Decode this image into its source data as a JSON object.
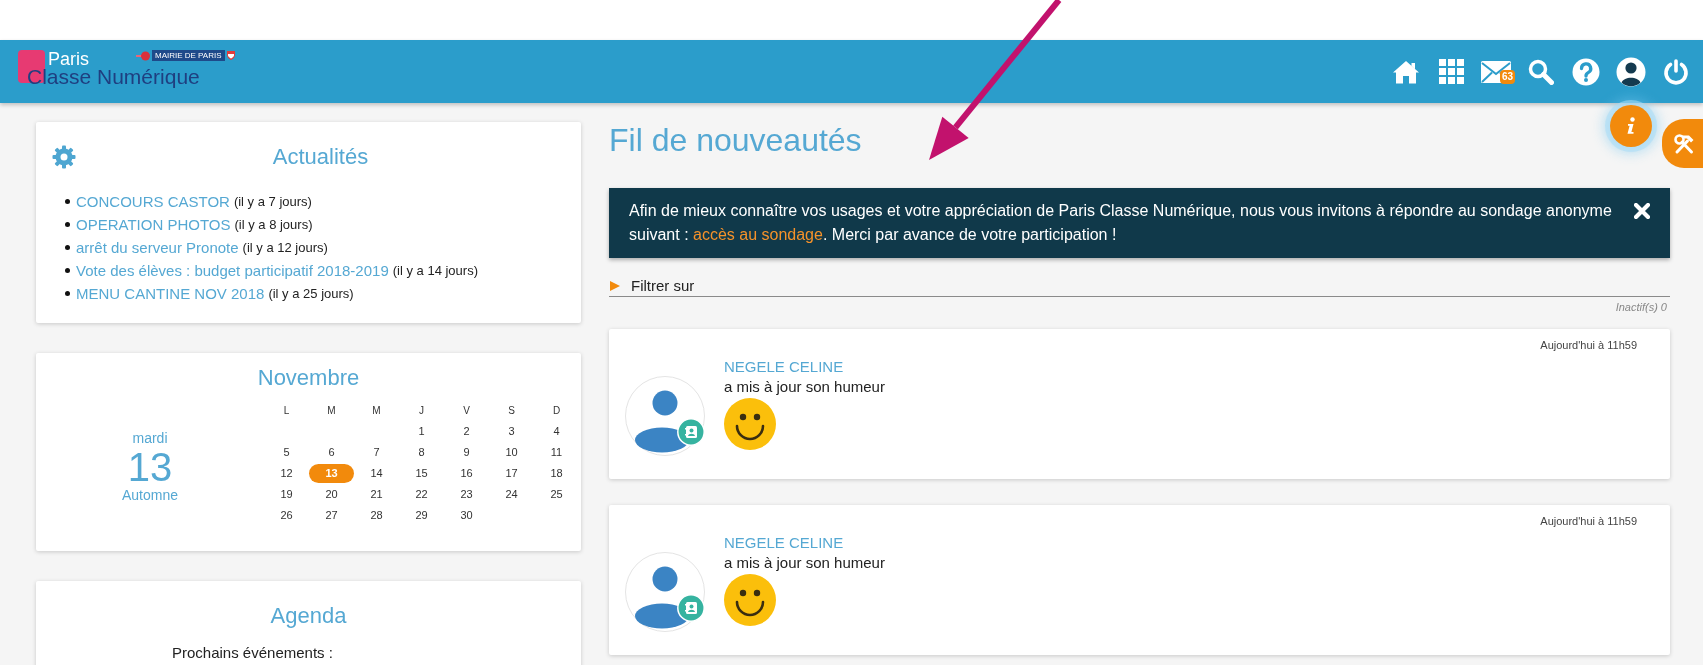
{
  "header": {
    "logo": {
      "line_1": "Paris",
      "line_2": "Classe Numérique",
      "badge": "MAIRIE DE PARIS"
    },
    "icons": [
      {
        "kind": "home"
      },
      {
        "kind": "apps"
      },
      {
        "kind": "mail",
        "badge": "63"
      },
      {
        "kind": "search"
      },
      {
        "kind": "help"
      },
      {
        "kind": "account"
      },
      {
        "kind": "power"
      }
    ]
  },
  "news_card": {
    "title": "Actualités",
    "items": [
      {
        "title": "CONCOURS CASTOR",
        "age": "(il y a 7 jours)"
      },
      {
        "title": "OPERATION PHOTOS",
        "age": "(il y a 8 jours)"
      },
      {
        "title": "arrêt du serveur Pronote",
        "age": "(il y a 12 jours)"
      },
      {
        "title": "Vote des élèves : budget participatif 2018-2019",
        "age": "(il y a 14 jours)"
      },
      {
        "title": "MENU CANTINE NOV 2018",
        "age": "(il y a 25 jours)"
      }
    ]
  },
  "calendar_card": {
    "month": "Novembre",
    "weekday": "mardi",
    "day": "13",
    "season": "Automne",
    "weekdays": [
      "L",
      "M",
      "M",
      "J",
      "V",
      "S",
      "D"
    ],
    "weeks": [
      [
        {
          "kind": "blank"
        },
        {
          "kind": "blank"
        },
        {
          "kind": "blank"
        },
        {
          "kind": "day",
          "label": "1",
          "selected": false
        },
        {
          "kind": "day",
          "label": "2",
          "selected": false
        },
        {
          "kind": "day",
          "label": "3",
          "selected": false
        },
        {
          "kind": "day",
          "label": "4",
          "selected": false
        }
      ],
      [
        {
          "kind": "day",
          "label": "5",
          "selected": false
        },
        {
          "kind": "day",
          "label": "6",
          "selected": false
        },
        {
          "kind": "day",
          "label": "7",
          "selected": false
        },
        {
          "kind": "day",
          "label": "8",
          "selected": false
        },
        {
          "kind": "day",
          "label": "9",
          "selected": false
        },
        {
          "kind": "day",
          "label": "10",
          "selected": false
        },
        {
          "kind": "day",
          "label": "11",
          "selected": false
        }
      ],
      [
        {
          "kind": "day",
          "label": "12",
          "selected": false
        },
        {
          "kind": "day",
          "label": "13",
          "selected": true
        },
        {
          "kind": "day",
          "label": "14",
          "selected": false
        },
        {
          "kind": "day",
          "label": "15",
          "selected": false
        },
        {
          "kind": "day",
          "label": "16",
          "selected": false
        },
        {
          "kind": "day",
          "label": "17",
          "selected": false
        },
        {
          "kind": "day",
          "label": "18",
          "selected": false
        }
      ],
      [
        {
          "kind": "day",
          "label": "19",
          "selected": false
        },
        {
          "kind": "day",
          "label": "20",
          "selected": false
        },
        {
          "kind": "day",
          "label": "21",
          "selected": false
        },
        {
          "kind": "day",
          "label": "22",
          "selected": false
        },
        {
          "kind": "day",
          "label": "23",
          "selected": false
        },
        {
          "kind": "day",
          "label": "24",
          "selected": false
        },
        {
          "kind": "day",
          "label": "25",
          "selected": false
        }
      ],
      [
        {
          "kind": "day",
          "label": "26",
          "selected": false
        },
        {
          "kind": "day",
          "label": "27",
          "selected": false
        },
        {
          "kind": "day",
          "label": "28",
          "selected": false
        },
        {
          "kind": "day",
          "label": "29",
          "selected": false
        },
        {
          "kind": "day",
          "label": "30",
          "selected": false
        },
        {
          "kind": "blank"
        },
        {
          "kind": "blank"
        }
      ]
    ]
  },
  "agenda_card": {
    "title": "Agenda",
    "subtitle": "Prochains événements :"
  },
  "feed": {
    "title": "Fil de nouveautés",
    "banner": {
      "text_before": "Afin de mieux connaître vos usages et votre appréciation de Paris Classe Numérique, nous vous invitons à répondre au sondage anonyme suivant : ",
      "link": "accès au sondage",
      "text_after": ". Merci par avance de votre participation !"
    },
    "filter": {
      "label": "Filtrer sur",
      "expanded": false
    },
    "inactive_count": "Inactif(s) 0",
    "posts": [
      {
        "author": "NEGELE CELINE",
        "action": "a mis à jour son humeur",
        "time": "Aujourd'hui à 11h59"
      },
      {
        "author": "NEGELE CELINE",
        "action": "a mis à jour son humeur",
        "time": "Aujourd'hui à 11h59"
      }
    ]
  },
  "floating_buttons": [
    {
      "kind": "info"
    },
    {
      "kind": "tools"
    }
  ],
  "annotations": [
    {
      "kind": "arrow"
    }
  ]
}
